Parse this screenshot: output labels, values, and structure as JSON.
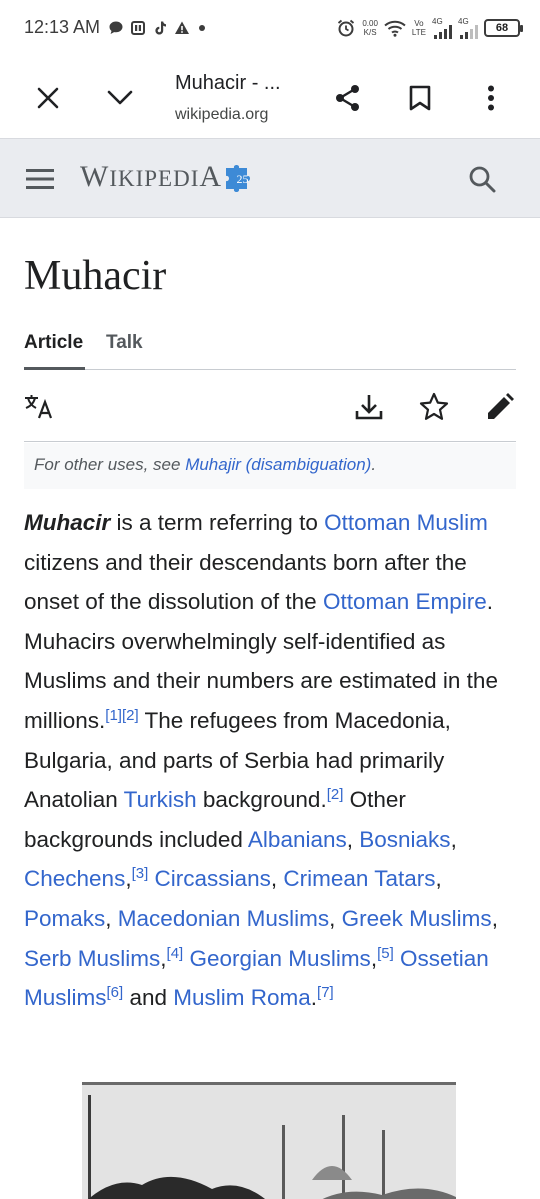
{
  "status_bar": {
    "time": "12:13 AM",
    "net_speed_value": "0.00",
    "net_speed_unit": "K/S",
    "volte_top": "Vo",
    "volte_bottom": "LTE",
    "signal1_label": "4G",
    "signal2_label": "4G",
    "battery": "68",
    "icons": [
      "chat-bubble-icon",
      "sim-icon",
      "tiktok-icon",
      "warning-icon",
      "dot-icon",
      "alarm-icon",
      "wifi-icon",
      "signal-icon",
      "battery-icon"
    ]
  },
  "toolbar": {
    "title": "Muhacir - ...",
    "url": "wikipedia.org",
    "icons": [
      "close-icon",
      "chevron-down-icon",
      "share-icon",
      "bookmark-icon",
      "more-vert-icon"
    ]
  },
  "wiki_header": {
    "wordmark": "Wikipedia",
    "badge": "25",
    "icons": [
      "hamburger-menu-icon",
      "search-icon"
    ]
  },
  "article": {
    "title": "Muhacir",
    "tabs": [
      {
        "label": "Article",
        "active": true
      },
      {
        "label": "Talk",
        "active": false
      }
    ],
    "action_icons": [
      "translate-icon",
      "download-icon",
      "star-icon",
      "edit-pencil-icon"
    ],
    "hatnote": {
      "prefix": "For other uses, see ",
      "link": "Muhajir (disambiguation)",
      "suffix": "."
    },
    "lead": {
      "term": "Muhacir",
      "t1": " is a term referring to ",
      "l1": "Ottoman Muslim",
      "t2": " citizens and their descendants born after the onset of the dissolution of the ",
      "l2": "Ottoman Empire",
      "t3": ". Muhacirs overwhelmingly self-identified as Muslims and their numbers are estimated in the millions.",
      "r1": "[1]",
      "r2": "[2]",
      "t4": " The refugees from Macedonia, Bulgaria, and parts of Serbia had primarily Anatolian ",
      "l3": "Turkish",
      "t5": " background.",
      "r3": "[2]",
      "t6": " Other backgrounds included ",
      "l4": "Albanians",
      "c1": ", ",
      "l5": "Bosniaks",
      "c2": ", ",
      "l6": "Chechens",
      "c3": ",",
      "r4": "[3]",
      "c4": " ",
      "l7": "Circassians",
      "c5": ", ",
      "l8": "Crimean Tatars",
      "c6": ", ",
      "l9": "Pomaks",
      "c7": ", ",
      "l10": "Macedonian Muslims",
      "c8": ", ",
      "l11": "Greek Muslims",
      "c9": ", ",
      "l12": "Serb Muslims",
      "c10": ",",
      "r5": "[4]",
      "c11": " ",
      "l13": "Georgian Muslims",
      "c12": ",",
      "r6": "[5]",
      "c13": " ",
      "l14": "Ossetian Muslims",
      "r7": "[6]",
      "t7": " and ",
      "l15": "Muslim Roma",
      "t8": ".",
      "r8": "[7]"
    }
  },
  "colors": {
    "link": "#3366cc",
    "text": "#202122",
    "header_bg": "#eaecf0",
    "muted": "#54595d"
  }
}
